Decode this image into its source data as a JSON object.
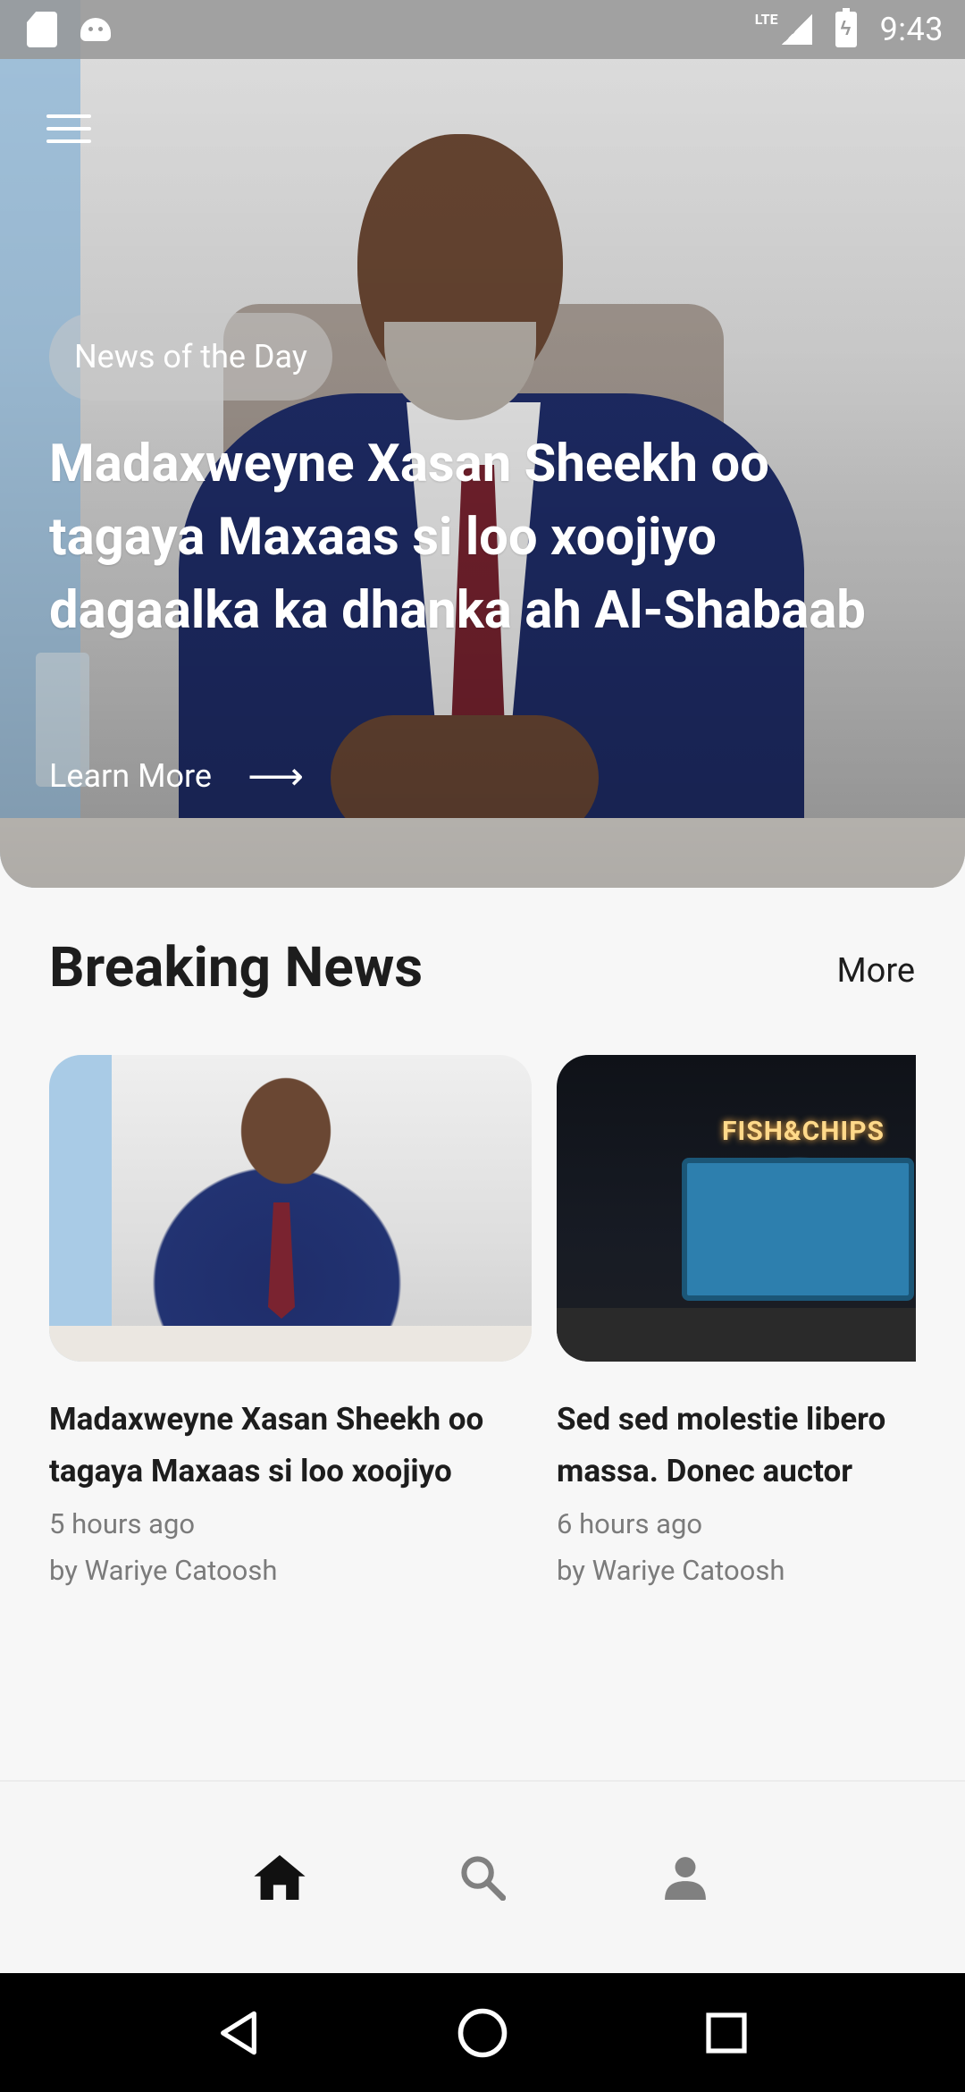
{
  "status_bar": {
    "network_label": "LTE",
    "time": "9:43",
    "icons": [
      "sd-card-icon",
      "android-icon",
      "signal-icon",
      "battery-charging-icon"
    ]
  },
  "hero": {
    "badge": "News of the Day",
    "title": "Madaxweyne Xasan Sheekh oo tagaya Maxaas si loo xoojiyo dagaalka ka dhanka ah Al-Shabaab",
    "learn_more": "Learn More",
    "arrow": "⟶"
  },
  "breaking_news": {
    "title": "Breaking News",
    "more": "More",
    "articles": [
      {
        "title_line1": "Madaxweyne Xasan Sheekh oo",
        "title_line2": "tagaya Maxaas si loo xoojiyo",
        "time": "5 hours ago",
        "author": "by Wariye Catoosh"
      },
      {
        "title_line1": "Sed sed molestie libero",
        "title_line2": "massa. Donec auctor",
        "time": "6 hours ago",
        "author": "by Wariye Catoosh",
        "image_sign": "FISH&CHIPS"
      }
    ]
  },
  "bottom_nav": {
    "items": [
      {
        "icon": "home-icon",
        "active": true
      },
      {
        "icon": "search-icon",
        "active": false
      },
      {
        "icon": "person-icon",
        "active": false
      }
    ],
    "active_color": "#111111",
    "inactive_color": "#808080"
  },
  "system_nav": {
    "buttons": [
      "back-icon",
      "home-circle-icon",
      "recents-icon"
    ]
  }
}
